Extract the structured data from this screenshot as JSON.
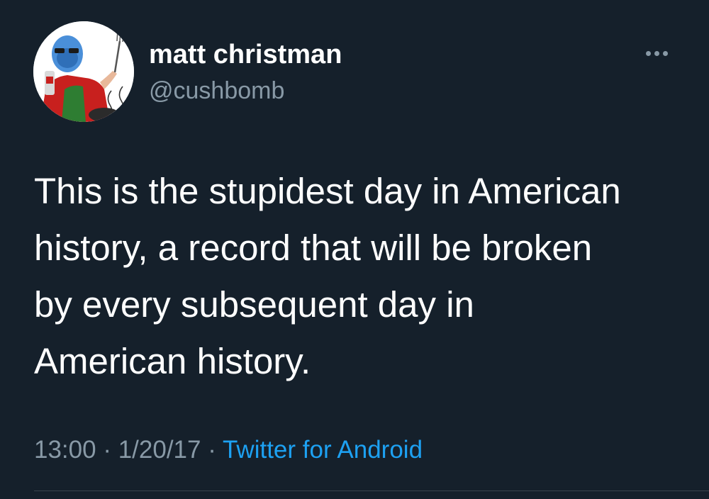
{
  "tweet": {
    "display_name": "matt christman",
    "handle": "@cushbomb",
    "body": "This is the stupidest day in American\nhistory, a record that will be broken\nby every subsequent day in\nAmerican history.",
    "time": "13:00",
    "date": "1/20/17",
    "separator": " · ",
    "source": "Twitter for Android"
  },
  "icons": {
    "more": "more-horizontal-icon",
    "avatar": "avatar-image"
  },
  "colors": {
    "background": "#15202b",
    "text": "#ffffff",
    "secondary_text": "#8899a6",
    "link": "#1da1f2",
    "divider": "#38444d"
  }
}
